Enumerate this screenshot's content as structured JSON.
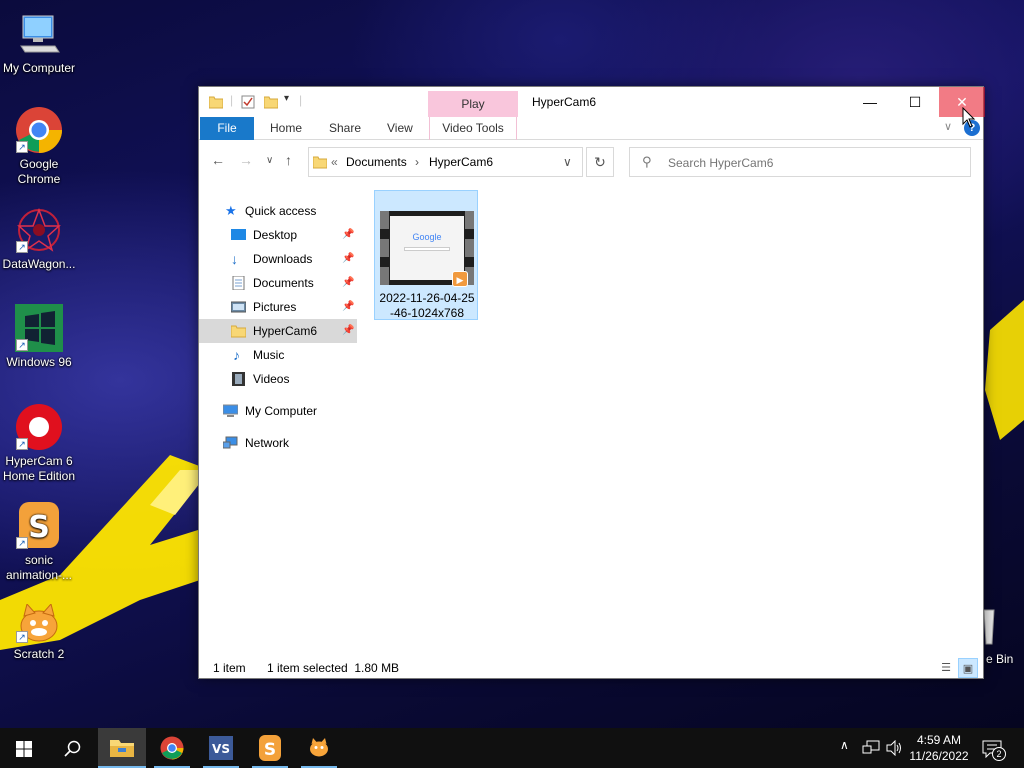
{
  "desktop": {
    "icons": [
      {
        "label": "My Computer",
        "icon": "computer-icon"
      },
      {
        "label": "Google Chrome",
        "icon": "chrome-icon"
      },
      {
        "label": "DataWagon...",
        "icon": "datawagon-icon"
      },
      {
        "label": "Windows 96",
        "icon": "windows96-icon"
      },
      {
        "label": "HyperCam 6 Home Edition",
        "icon": "hypercam-icon"
      },
      {
        "label": "sonic animation-...",
        "icon": "sonic-icon"
      },
      {
        "label": "Scratch 2",
        "icon": "scratch-icon"
      }
    ],
    "recycle_bin_label": "e Bin"
  },
  "window": {
    "title": "HyperCam6",
    "context_tab": "Play",
    "ribbon_tabs": [
      "File",
      "Home",
      "Share",
      "View",
      "Video Tools"
    ],
    "address": {
      "overflow": "«",
      "segments": [
        "Documents",
        "HyperCam6"
      ]
    },
    "search": {
      "placeholder": "Search HyperCam6"
    },
    "nav": {
      "quick_access": "Quick access",
      "pinned": [
        {
          "label": "Desktop",
          "icon": "desktop-folder-icon"
        },
        {
          "label": "Downloads",
          "icon": "downloads-folder-icon"
        },
        {
          "label": "Documents",
          "icon": "documents-folder-icon"
        },
        {
          "label": "Pictures",
          "icon": "pictures-folder-icon"
        },
        {
          "label": "HyperCam6",
          "icon": "folder-icon"
        }
      ],
      "unpinned": [
        {
          "label": "Music",
          "icon": "music-folder-icon"
        },
        {
          "label": "Videos",
          "icon": "videos-folder-icon"
        }
      ],
      "my_computer": "My Computer",
      "network": "Network"
    },
    "files": [
      {
        "name": "2022-11-26-04-25-46-1024x768",
        "name_line1": "2022-11-26-04-25",
        "name_line2": "-46-1024x768",
        "thumb_text": "Google",
        "selected": true
      }
    ],
    "status": {
      "count": "1 item",
      "selection": "1 item selected  1.80 MB"
    }
  },
  "taskbar": {
    "items": [
      "start-button",
      "search-button",
      "file-explorer",
      "chrome",
      "visual-studio",
      "sonic",
      "scratch"
    ],
    "clock_time": "4:59 AM",
    "clock_date": "11/26/2022",
    "notification_count": "2"
  },
  "colors": {
    "accent": "#1979ca",
    "selection": "#cce8ff",
    "context_tab": "#f9c6dc",
    "close_hover": "#e81123"
  }
}
